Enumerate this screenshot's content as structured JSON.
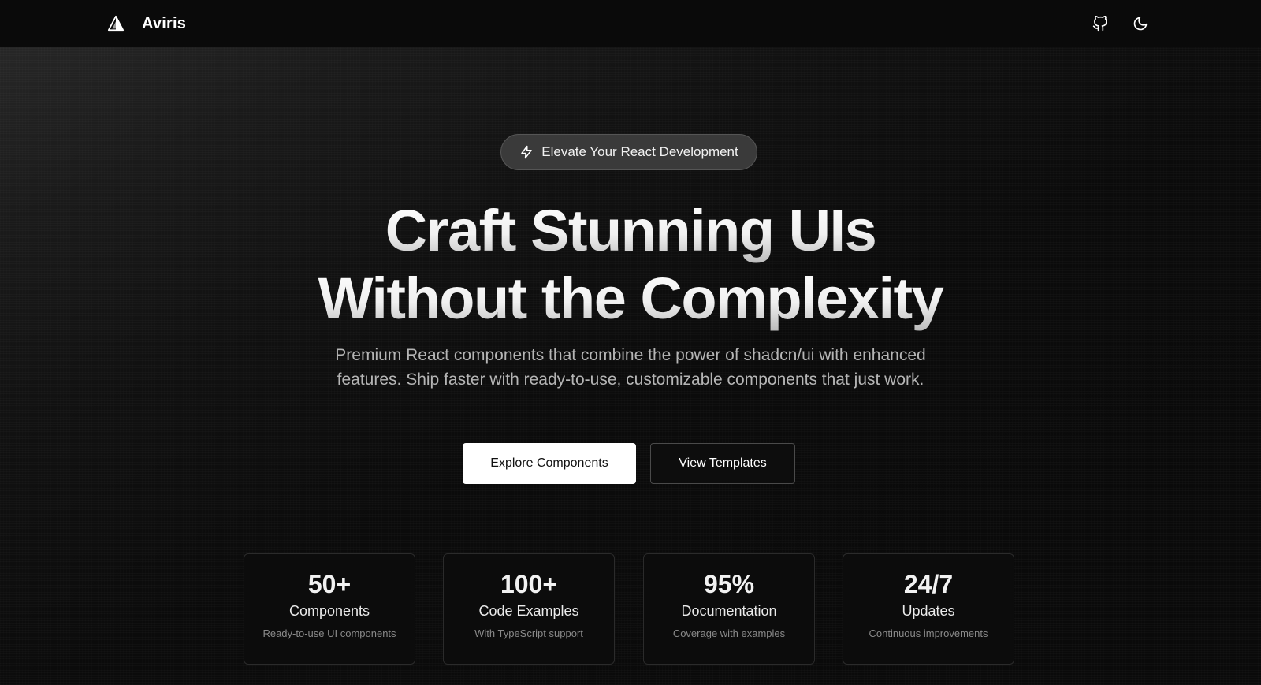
{
  "header": {
    "brand_name": "Aviris",
    "logo_icon": "triangle-logo-icon",
    "github_icon": "github-icon",
    "theme_icon": "moon-icon"
  },
  "hero": {
    "badge_icon": "lightning-icon",
    "badge_text": "Elevate Your React Development",
    "headline_line1": "Craft Stunning UIs",
    "headline_line2": "Without the Complexity",
    "subtitle": "Premium React components that combine the power of shadcn/ui with enhanced features. Ship faster with ready-to-use, customizable components that just work.",
    "primary_button": "Explore Components",
    "secondary_button": "View Templates"
  },
  "stats": [
    {
      "value": "50+",
      "title": "Components",
      "desc": "Ready-to-use UI components"
    },
    {
      "value": "100+",
      "title": "Code Examples",
      "desc": "With TypeScript support"
    },
    {
      "value": "95%",
      "title": "Documentation",
      "desc": "Coverage with examples"
    },
    {
      "value": "24/7",
      "title": "Updates",
      "desc": "Continuous improvements"
    }
  ],
  "colors": {
    "background": "#0b0b0b",
    "primary_button_bg": "#ffffff",
    "text": "#ffffff"
  }
}
